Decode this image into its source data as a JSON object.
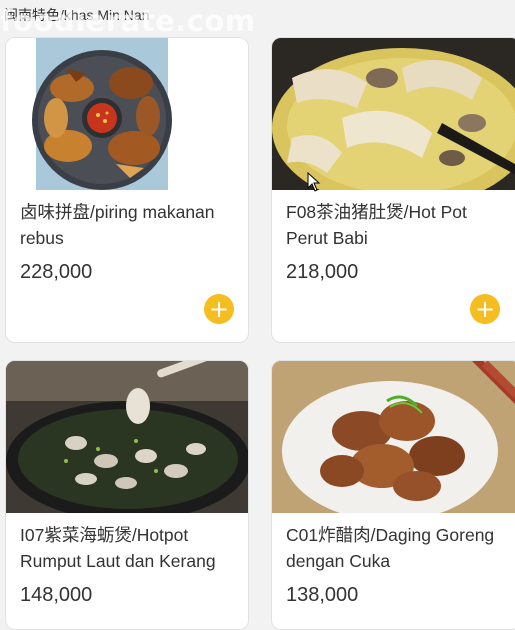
{
  "section": {
    "title": "闽南特色/khas Min Nan",
    "watermark": "foodierate.com"
  },
  "colors": {
    "accent": "#f5bd1f",
    "card_bg": "#ffffff",
    "page_bg": "#f2f2f2"
  },
  "items": [
    {
      "name": "卤味拼盘/piring makanan rebus",
      "price": "228,000",
      "add_icon": "plus-icon"
    },
    {
      "name": "F08茶油猪肚煲/Hot Pot Perut Babi",
      "price": "218,000",
      "add_icon": "plus-icon"
    },
    {
      "name": "I07紫菜海蛎煲/Hotpot Rumput Laut dan Kerang",
      "price": "148,000"
    },
    {
      "name": "C01炸醋肉/Daging Goreng dengan Cuka",
      "price": "138,000"
    }
  ]
}
